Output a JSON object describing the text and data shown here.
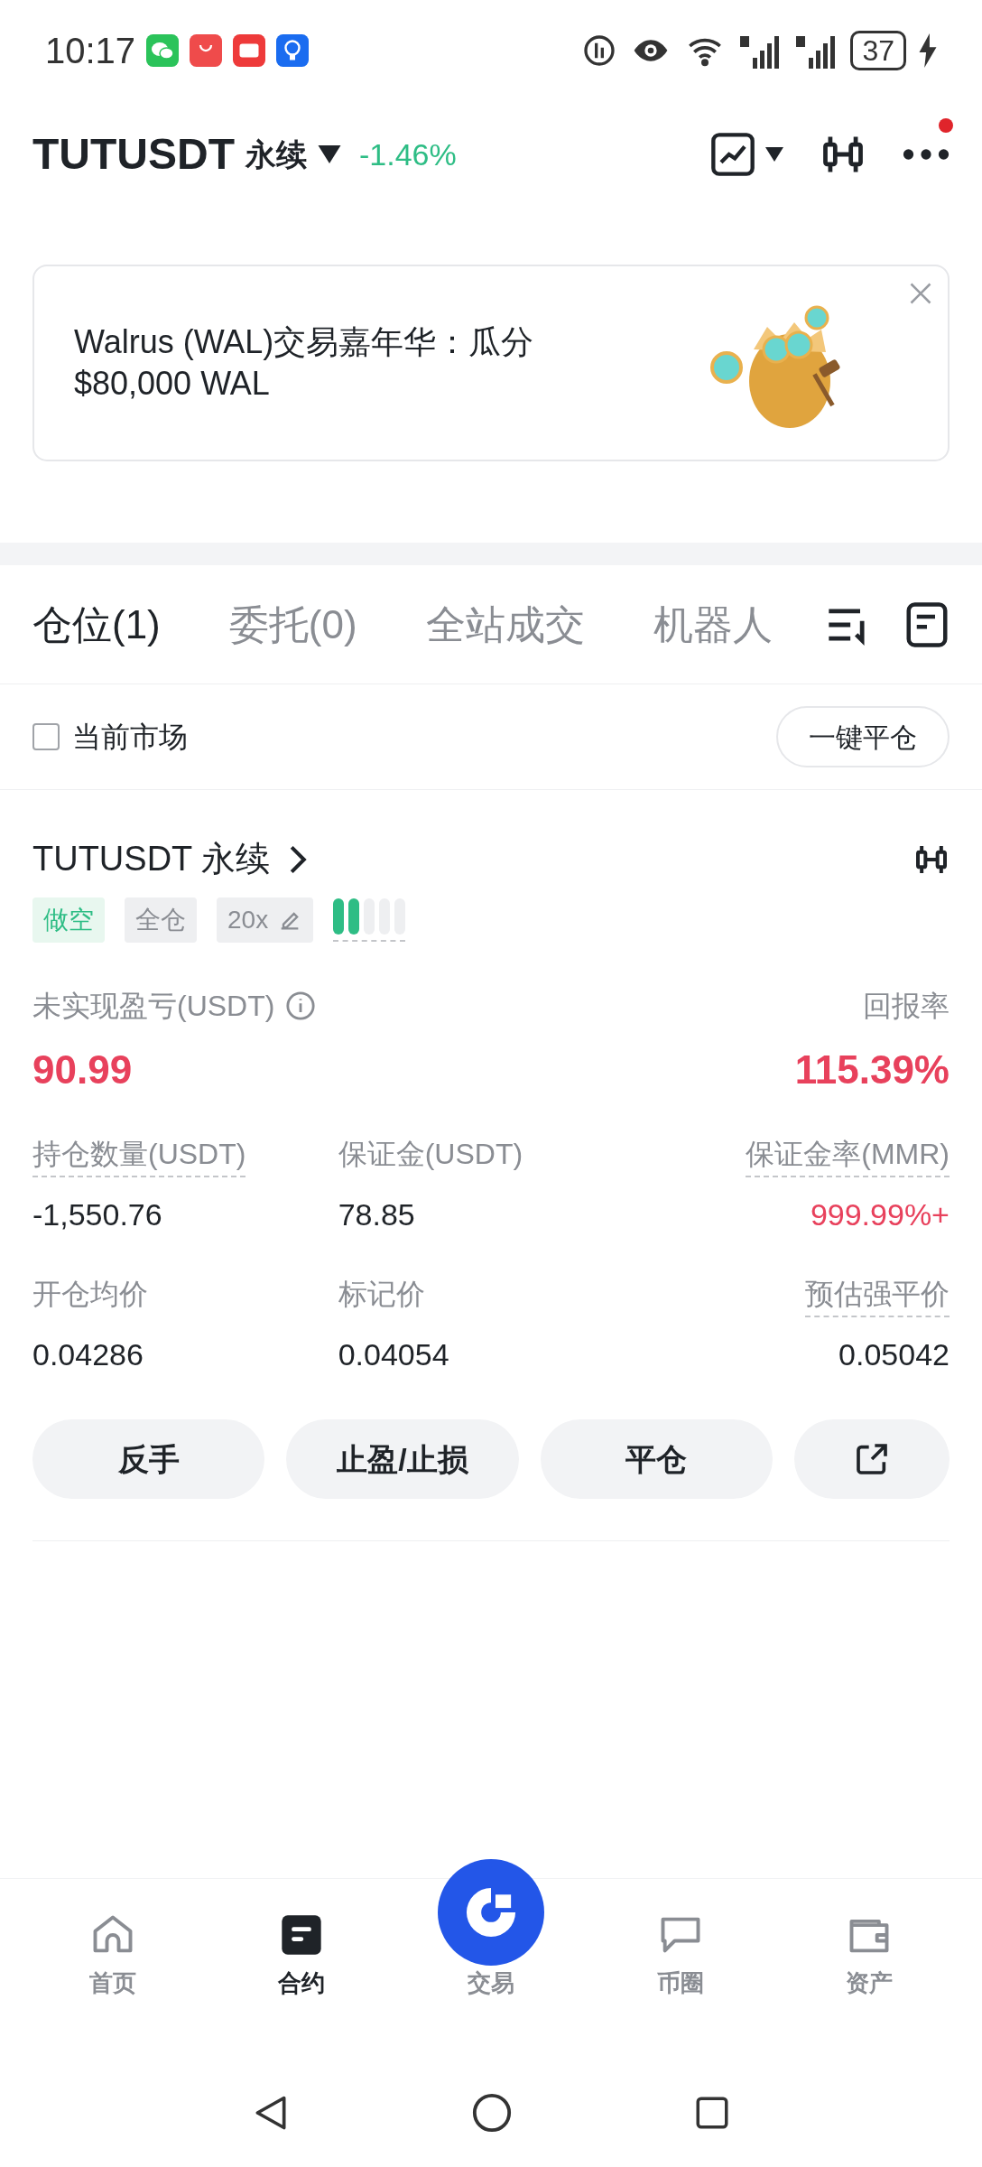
{
  "status_bar": {
    "time": "10:17",
    "battery": "37"
  },
  "header": {
    "symbol": "TUTUSDT",
    "contract": "永续",
    "change": "-1.46%",
    "notification_dot": true
  },
  "banner": {
    "text": "Walrus (WAL)交易嘉年华：瓜分\n$80,000 WAL"
  },
  "tabs": [
    {
      "label": "仓位(1)",
      "selected": true
    },
    {
      "label": "委托(0)",
      "selected": false
    },
    {
      "label": "全站成交",
      "selected": false
    },
    {
      "label": "机器人",
      "selected": false
    }
  ],
  "filter": {
    "label": "当前市场",
    "checked": false,
    "button": "一键平仓"
  },
  "position": {
    "symbol": "TUTUSDT 永续",
    "side": "做空",
    "margin_mode": "全仓",
    "leverage": "20x",
    "pnl_label": "未实现盈亏(USDT)",
    "pnl": "90.99",
    "roe_label": "回报率",
    "roe": "115.39%",
    "stats": [
      {
        "label": "持仓数量(USDT)",
        "value": "-1,550.76",
        "dotted": true,
        "red": false
      },
      {
        "label": "保证金(USDT)",
        "value": "78.85",
        "dotted": false,
        "red": false
      },
      {
        "label": "保证金率(MMR)",
        "value": "999.99%+",
        "dotted": true,
        "red": true
      },
      {
        "label": "开仓均价",
        "value": "0.04286",
        "dotted": false,
        "red": false
      },
      {
        "label": "标记价",
        "value": "0.04054",
        "dotted": false,
        "red": false
      },
      {
        "label": "预估强平价",
        "value": "0.05042",
        "dotted": true,
        "red": false
      }
    ],
    "actions": [
      "反手",
      "止盈/止损",
      "平仓"
    ]
  },
  "bottom_nav": [
    {
      "label": "首页",
      "kind": "home",
      "selected": false
    },
    {
      "label": "合约",
      "kind": "futures",
      "selected": true
    },
    {
      "label": "交易",
      "kind": "center",
      "selected": false
    },
    {
      "label": "币圈",
      "kind": "chat",
      "selected": false
    },
    {
      "label": "资产",
      "kind": "wallet",
      "selected": false
    }
  ]
}
